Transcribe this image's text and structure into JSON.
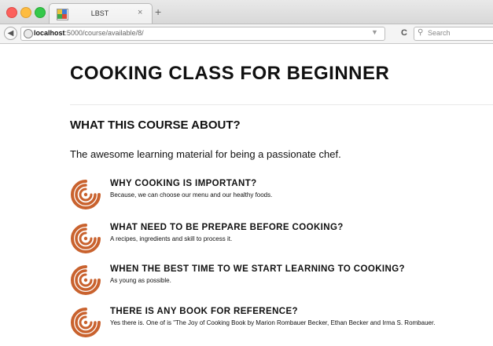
{
  "browser": {
    "tab_title": "LBST",
    "tab_close": "×",
    "new_tab": "+",
    "url_host": "localhost",
    "url_rest": ":5000/course/available/8/",
    "search_placeholder": "Search",
    "reload": "C"
  },
  "page": {
    "title": "COOKING CLASS FOR BEGINNER",
    "section_title": "WHAT THIS COURSE ABOUT?",
    "lead": "The awesome learning material for being a passionate chef."
  },
  "items": [
    {
      "title": "WHY COOKING IS IMPORTANT?",
      "desc": "Because, we can choose our menu and our healthy foods.",
      "icon": "spiral-icon"
    },
    {
      "title": "WHAT NEED TO BE PREPARE BEFORE COOKING?",
      "desc": "A recipes, ingredients and skill to process it.",
      "icon": "spiral-icon"
    },
    {
      "title": "WHEN THE BEST TIME TO WE START LEARNING TO COOKING?",
      "desc": "As young as possible.",
      "icon": "spiral-icon"
    },
    {
      "title": "THERE IS ANY BOOK FOR REFERENCE?",
      "desc": "Yes there is. One of is \"The Joy of Cooking Book by Marion Rombauer Becker, Ethan Becker and Irma S. Rombauer.",
      "icon": "spiral-icon"
    }
  ],
  "colors": {
    "icon": "#c9622e"
  }
}
